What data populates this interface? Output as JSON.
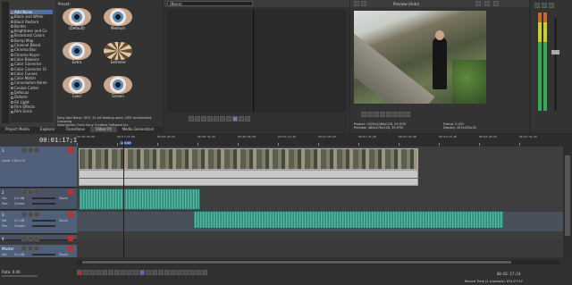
{
  "explorer": {
    "items": [
      "Add Noise",
      "Black and White",
      "Black Restore",
      "Border",
      "Brightness and Co",
      "Broadcast Colors",
      "Bump Map",
      "Channel Blend",
      "Chroma Blur",
      "Chroma Keyer",
      "Color Balance",
      "Color Corrector",
      "Color Corrector (S",
      "Color Curves",
      "Color Match",
      "Convolution Kerne",
      "Cookie Cutter",
      "Defocus",
      "Deform",
      "Fill Light",
      "Film Effects",
      "Film Grain"
    ],
    "selected_index": 0
  },
  "presets": {
    "header": "Preset:",
    "items": [
      {
        "label": "(Default)"
      },
      {
        "label": "Medium"
      },
      {
        "label": "Extra"
      },
      {
        "label": "Extreme"
      },
      {
        "label": "Color"
      },
      {
        "label": "Screen"
      }
    ],
    "description": "Sony Add Noise: OFX, 32-bit floating point, GPU Accelerated, Grouping",
    "description2": "Description: From Sony Creative Software Inc."
  },
  "bottom_tabs": [
    "Project Media",
    "Explorer",
    "Transitions",
    "Video FX",
    "Media Generators"
  ],
  "trimmer": {
    "title": "(None)"
  },
  "preview": {
    "title": "Preview (Auto)",
    "project_label": "Project:",
    "project_value": "1920x1080x128, 29.970i",
    "preview_label": "Preview:",
    "preview_value": "480x270x128, 29.970i",
    "frame_label": "Frame:",
    "frame_value": "2,051",
    "display_label": "Display:",
    "display_value": "453x255x32"
  },
  "timeline": {
    "timecode": "00:01:17;14",
    "ruler_labels": [
      "00:00:00;00",
      "00:00:15;00",
      "00:00:29;29",
      "00:00:44;29",
      "00:00:59;28",
      "00:01:14;28",
      "00:01:29;29",
      "00:01:44;29",
      "00:01:59;28",
      "00:02:14;28",
      "00:02:29;29",
      "00:02:44;29"
    ],
    "badge": "+40:43"
  },
  "tracks": [
    {
      "type": "video",
      "number": "1",
      "level_label": "Level: 100.0 %"
    },
    {
      "type": "audio",
      "number": "2",
      "vol_label": "Vol:",
      "vol_value": "0.0 dB",
      "pan_label": "Pan:",
      "pan_value": "Center",
      "touch_label": "Touch"
    },
    {
      "type": "audio",
      "number": "3",
      "vol_label": "Vol:",
      "vol_value": "0.0 dB",
      "pan_label": "Pan:",
      "pan_value": "Center",
      "touch_label": "Touch"
    },
    {
      "type": "audio",
      "number": "4",
      "vol_label": "Vol:",
      "vol_value": "0.0 dB",
      "pan_label": "Pan:",
      "pan_value": "Center",
      "touch_label": "Touch"
    },
    {
      "type": "master",
      "label": "Master",
      "vol_label": "Vol:",
      "vol_value": "0.0 dB",
      "touch_label": "Touch"
    }
  ],
  "status": {
    "rate": "Rate: 0.00",
    "selection_start": "00:01:17;14",
    "record_time": "Record Time (2 channels): 874:27:57"
  }
}
